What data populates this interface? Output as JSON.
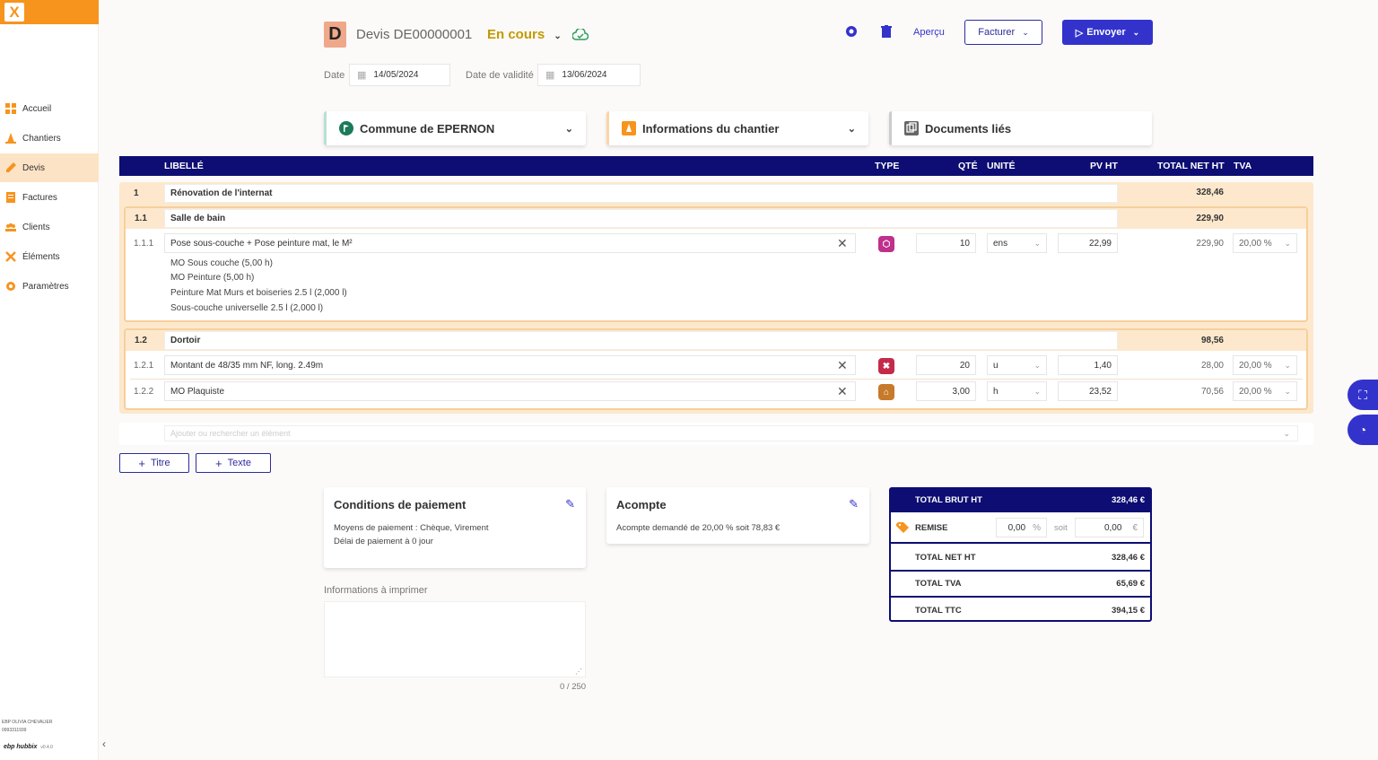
{
  "sidebar": {
    "items": [
      {
        "label": "Accueil",
        "color": "#f7941d"
      },
      {
        "label": "Chantiers",
        "color": "#f7941d"
      },
      {
        "label": "Devis",
        "color": "#f7941d"
      },
      {
        "label": "Factures",
        "color": "#f7941d"
      },
      {
        "label": "Clients",
        "color": "#f7941d"
      },
      {
        "label": "Éléments",
        "color": "#f7941d"
      },
      {
        "label": "Paramètres",
        "color": "#f7941d"
      }
    ],
    "active_item": "Devis",
    "footer_user": "EBP OLIVIA CHEVALIER",
    "footer_id": "0993311939",
    "footer_brand": "ebp hubbix",
    "footer_version": "v0.4.0"
  },
  "header": {
    "badge": "D",
    "title": "Devis DE00000001",
    "status": "En cours",
    "apercu": "Aperçu",
    "facturer": "Facturer",
    "envoyer": "Envoyer"
  },
  "dates": {
    "date_label": "Date",
    "date_value": "14/05/2024",
    "validity_label": "Date de validité",
    "validity_value": "13/06/2024"
  },
  "cards": {
    "client": "Commune de EPERNON",
    "chantier": "Informations du chantier",
    "documents": "Documents liés"
  },
  "table": {
    "headers": {
      "libelle": "LIBELLÉ",
      "type": "TYPE",
      "qte": "QTÉ",
      "unite": "UNITÉ",
      "pvht": "PV HT",
      "total": "TOTAL NET HT",
      "tva": "TVA"
    },
    "section": {
      "num": "1",
      "title": "Rénovation de l'internat",
      "total": "328,46"
    },
    "group1": {
      "num": "1.1",
      "title": "Salle de bain",
      "total": "229,90"
    },
    "row111": {
      "num": "1.1.1",
      "label": "Pose sous-couche + Pose peinture mat, le M²",
      "qte": "10",
      "unite": "ens",
      "pvht": "22,99",
      "total": "229,90",
      "tva": "20,00 %",
      "sublines": [
        "MO Sous couche (5,00 h)",
        "MO Peinture (5,00 h)",
        "Peinture Mat Murs et boiseries 2.5 l (2,000 l)",
        "Sous-couche universelle 2.5 l (2,000 l)"
      ]
    },
    "group2": {
      "num": "1.2",
      "title": "Dortoir",
      "total": "98,56"
    },
    "row121": {
      "num": "1.2.1",
      "label": "Montant de 48/35 mm NF, long. 2.49m",
      "qte": "20",
      "unite": "u",
      "pvht": "1,40",
      "total": "28,00",
      "tva": "20,00 %"
    },
    "row122": {
      "num": "1.2.2",
      "label": "MO Plaquiste",
      "qte": "3,00",
      "unite": "h",
      "pvht": "23,52",
      "total": "70,56",
      "tva": "20,00 %"
    },
    "add_placeholder": "Ajouter ou rechercher un élément"
  },
  "actions": {
    "titre": "Titre",
    "texte": "Texte"
  },
  "payment": {
    "title": "Conditions de paiement",
    "line1": "Moyens de paiement : Chèque, Virement",
    "line2": "Délai de paiement à 0 jour"
  },
  "acompte": {
    "title": "Acompte",
    "line1": "Acompte demandé de 20,00 % soit 78,83 €"
  },
  "print_info": {
    "label": "Informations à imprimer",
    "counter": "0 / 250"
  },
  "totals": {
    "brut_label": "TOTAL BRUT HT",
    "brut_value": "328,46 €",
    "remise_label": "REMISE",
    "remise_pct": "0,00",
    "pct_sign": "%",
    "soit": "soit",
    "remise_amount": "0,00",
    "euro_sign": "€",
    "net_label": "TOTAL NET HT",
    "net_value": "328,46 €",
    "tva_label": "TOTAL TVA",
    "tva_value": "65,69 €",
    "ttc_label": "TOTAL TTC",
    "ttc_value": "394,15 €"
  },
  "colors": {
    "accent": "#f7941d",
    "primary": "#0d0d73",
    "button": "#3333cc",
    "status": "#c49a00"
  }
}
